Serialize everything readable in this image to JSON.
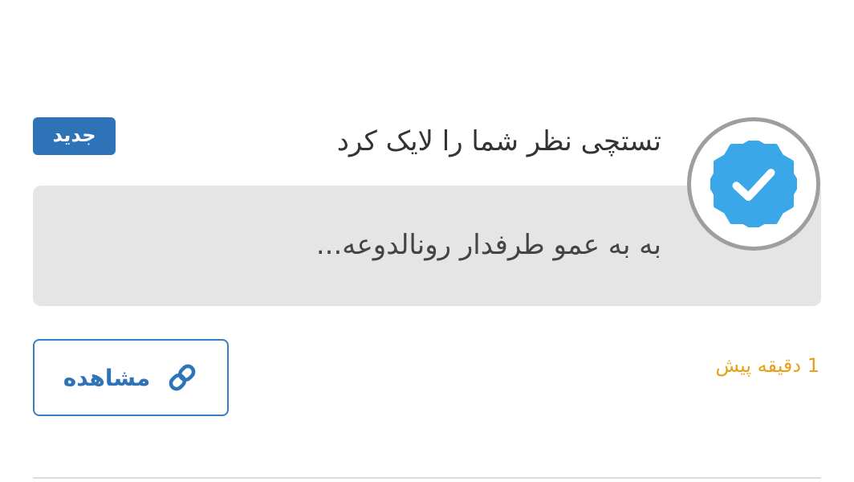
{
  "notification": {
    "title": "تستچی نظر شما را لایک کرد",
    "badge": "جدید",
    "comment": "به به عمو طرفدار رونالدوعه...",
    "time": "1 دقیقه پیش",
    "view_button_label": "مشاهده",
    "avatar_icon": "verified-badge-icon",
    "link_icon": "link-icon"
  },
  "colors": {
    "badge_bg": "#2e73b8",
    "accent": "#2e73b8",
    "verified": "#3aa8e8",
    "time": "#e6a11a",
    "comment_bg": "#e5e5e5"
  }
}
